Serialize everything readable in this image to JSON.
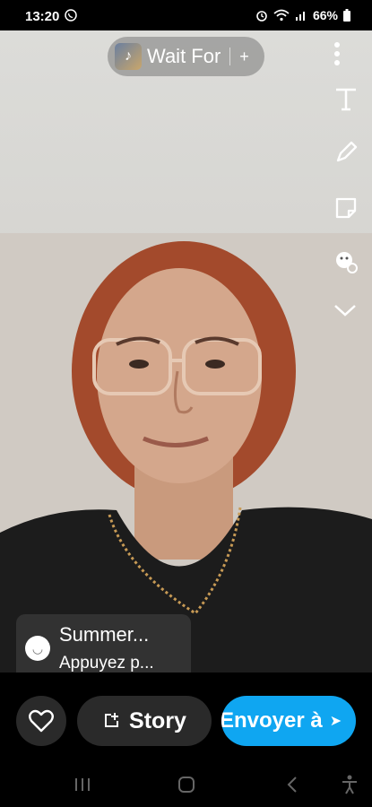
{
  "status_bar": {
    "time": "13:20",
    "battery": "66%"
  },
  "music": {
    "title": "Wait For",
    "add": "+"
  },
  "caption": {
    "line1": "Summer...",
    "line2": "Appuyez p..."
  },
  "actions": {
    "story_label": "Story",
    "send_label": "Envoyer à"
  },
  "colors": {
    "send": "#0fa6f1",
    "dark_button": "#2a2a2a"
  },
  "icons": [
    "whatsapp-icon",
    "alarm-icon",
    "wifi-icon",
    "signal-icon",
    "battery-icon",
    "more-vertical-icon",
    "text-tool-icon",
    "pencil-icon",
    "sticker-icon",
    "lens-icon",
    "chevron-down-icon",
    "heart-icon",
    "story-add-icon",
    "send-arrow-icon",
    "recents-nav-icon",
    "home-nav-icon",
    "back-nav-icon",
    "accessibility-nav-icon"
  ]
}
